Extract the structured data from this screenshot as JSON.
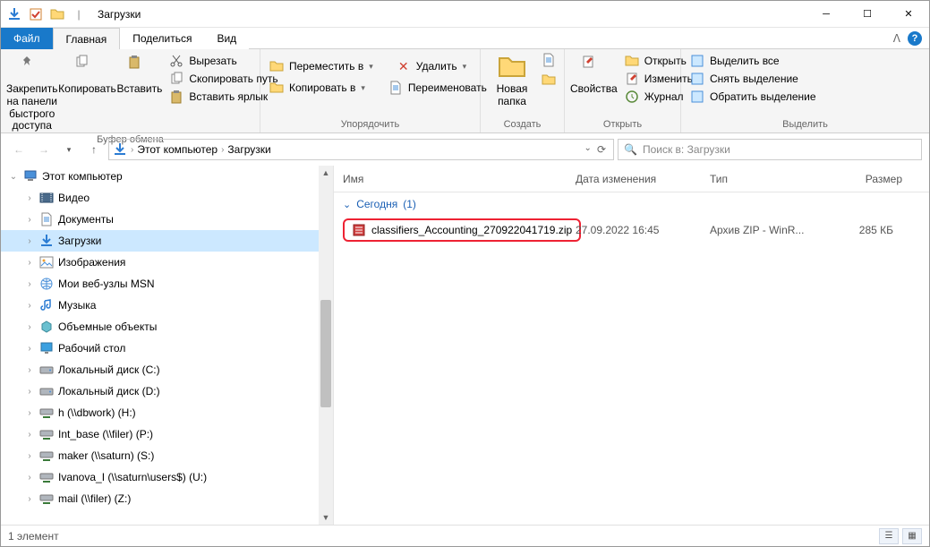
{
  "window": {
    "title": "Загрузки"
  },
  "tabs": {
    "file": "Файл",
    "home": "Главная",
    "share": "Поделиться",
    "view": "Вид"
  },
  "ribbon": {
    "clipboard": {
      "label": "Буфер обмена",
      "pin": "Закрепить на панели\nбыстрого доступа",
      "copy": "Копировать",
      "paste": "Вставить",
      "cut": "Вырезать",
      "copypath": "Скопировать путь",
      "pastelink": "Вставить ярлык"
    },
    "organize": {
      "label": "Упорядочить",
      "moveto": "Переместить в",
      "copyto": "Копировать в",
      "delete": "Удалить",
      "rename": "Переименовать"
    },
    "create": {
      "label": "Создать",
      "newfolder": "Новая\nпапка"
    },
    "open": {
      "label": "Открыть",
      "props": "Свойства",
      "open": "Открыть",
      "edit": "Изменить",
      "history": "Журнал"
    },
    "select": {
      "label": "Выделить",
      "all": "Выделить все",
      "none": "Снять выделение",
      "invert": "Обратить выделение"
    }
  },
  "breadcrumb": {
    "pc": "Этот компьютер",
    "dl": "Загрузки"
  },
  "search": {
    "placeholder": "Поиск в: Загрузки"
  },
  "tree": {
    "root": "Этот компьютер",
    "items": [
      {
        "label": "Видео",
        "icon": "video"
      },
      {
        "label": "Документы",
        "icon": "doc"
      },
      {
        "label": "Загрузки",
        "icon": "download",
        "sel": true
      },
      {
        "label": "Изображения",
        "icon": "image"
      },
      {
        "label": "Мои веб-узлы MSN",
        "icon": "web"
      },
      {
        "label": "Музыка",
        "icon": "music"
      },
      {
        "label": "Объемные объекты",
        "icon": "3d"
      },
      {
        "label": "Рабочий стол",
        "icon": "desktop"
      },
      {
        "label": "Локальный диск (C:)",
        "icon": "disk"
      },
      {
        "label": "Локальный диск (D:)",
        "icon": "disk"
      },
      {
        "label": "h (\\\\dbwork) (H:)",
        "icon": "netdisk"
      },
      {
        "label": "Int_base (\\\\filer) (P:)",
        "icon": "netdisk"
      },
      {
        "label": "maker (\\\\saturn) (S:)",
        "icon": "netdisk"
      },
      {
        "label": "Ivanova_I (\\\\saturn\\users$) (U:)",
        "icon": "netdisk"
      },
      {
        "label": "mail (\\\\filer) (Z:)",
        "icon": "netdisk"
      }
    ]
  },
  "columns": {
    "name": "Имя",
    "date": "Дата изменения",
    "type": "Тип",
    "size": "Размер"
  },
  "group": {
    "label": "Сегодня",
    "count": "(1)"
  },
  "file": {
    "name": "classifiers_Accounting_270922041719.zip",
    "date": "27.09.2022 16:45",
    "type": "Архив ZIP - WinR...",
    "size": "285 КБ"
  },
  "status": {
    "text": "1 элемент"
  }
}
